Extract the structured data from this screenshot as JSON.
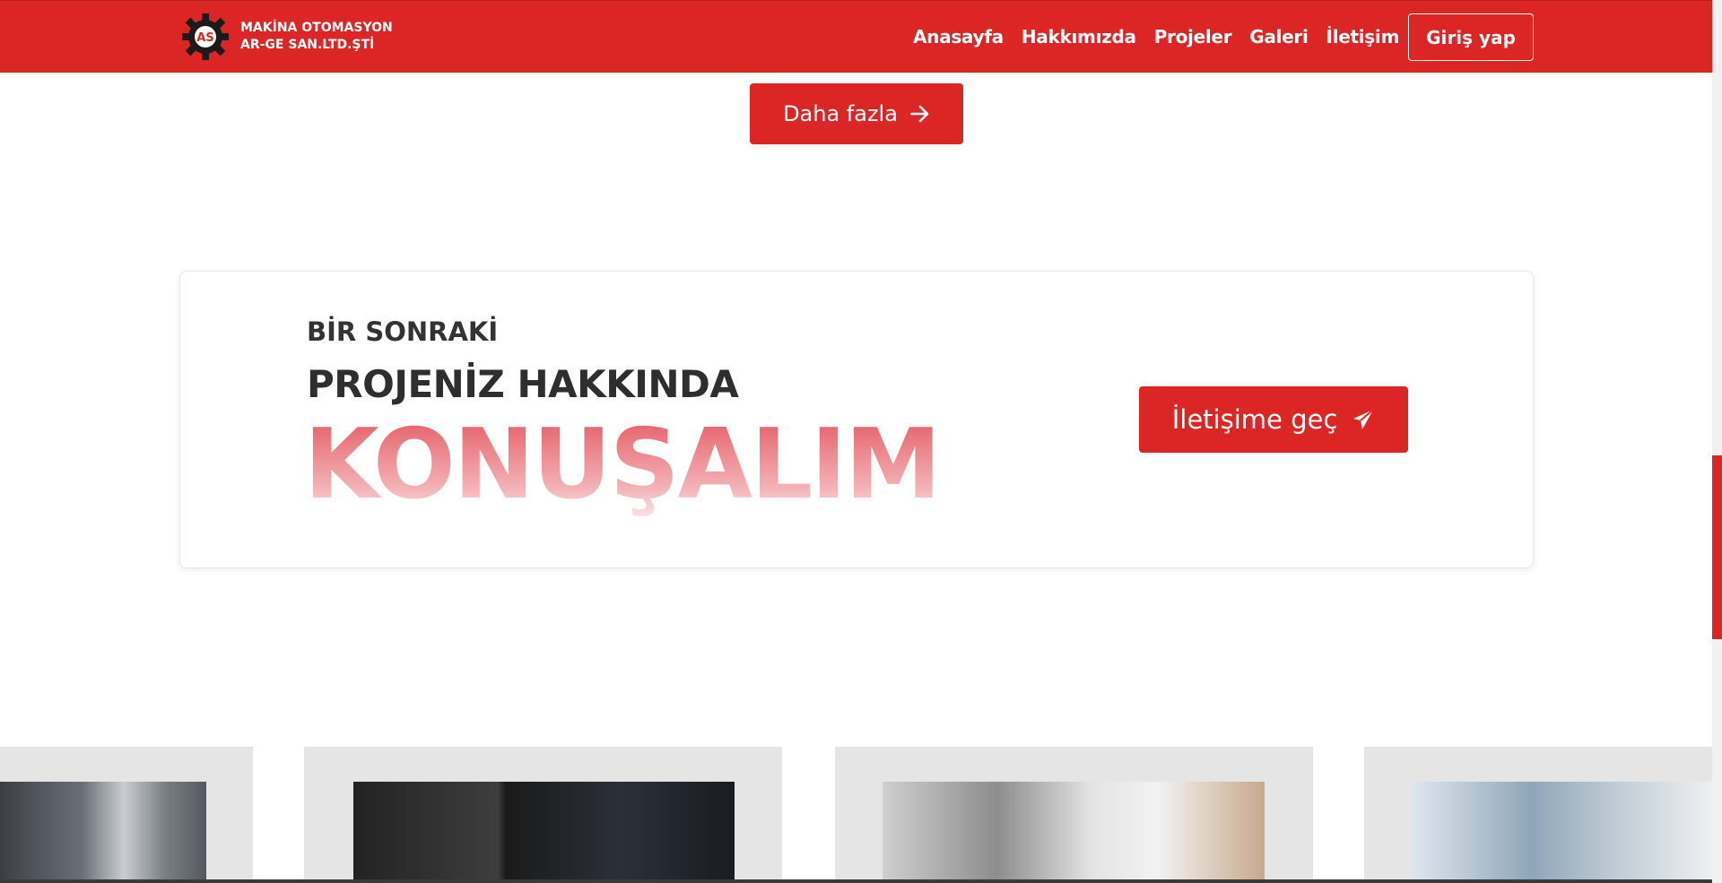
{
  "header": {
    "logo_line1": "MAKİNA OTOMASYON",
    "logo_line2": "AR-GE SAN.LTD.ŞTİ",
    "logo_badge": "AS",
    "nav": [
      "Anasayfa",
      "Hakkımızda",
      "Projeler",
      "Galeri",
      "İletişim"
    ],
    "login_label": "Giriş yap"
  },
  "more_label": "Daha fazla",
  "cta": {
    "line1": "BİR SONRAKİ",
    "line2": "PROJENİZ HAKKINDA",
    "line3": "KONUŞALIM",
    "button_label": "İletişime geç"
  },
  "colors": {
    "brand_red": "#dc2626",
    "card_gray": "#e5e5e5"
  },
  "icons": [
    "gear-logo-icon",
    "arrow-right-icon",
    "paper-plane-icon"
  ]
}
